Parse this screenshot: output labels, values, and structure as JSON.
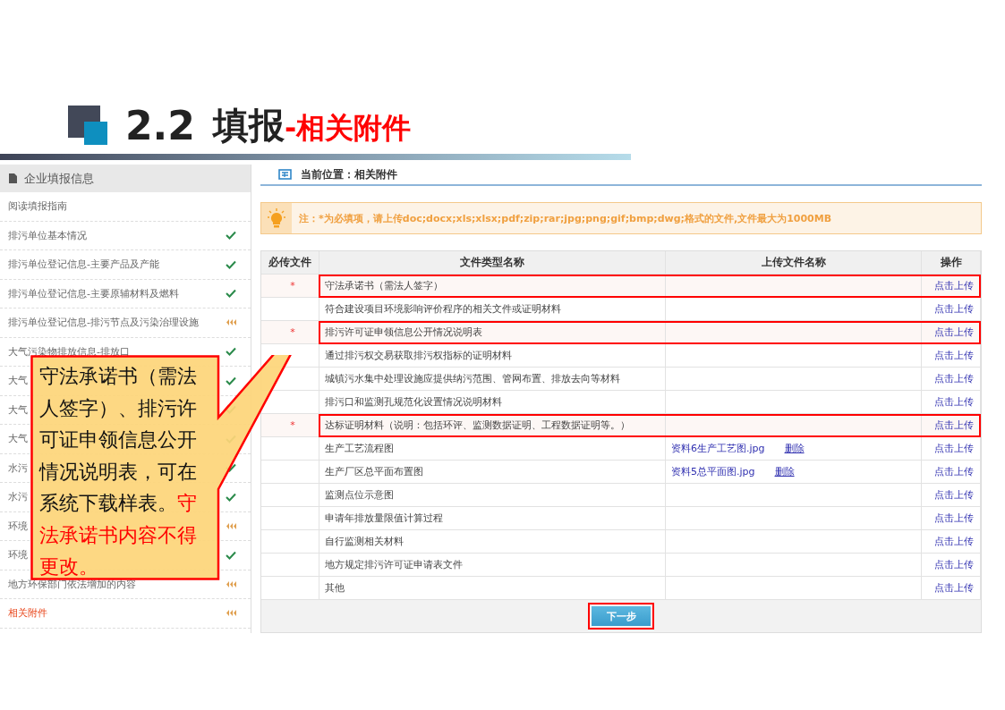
{
  "slide_title": {
    "number": "2.2",
    "main": "填报",
    "sub": "-相关附件"
  },
  "sidebar": {
    "title": "企业填报信息",
    "items": [
      {
        "label": "阅读填报指南",
        "selected": false
      },
      {
        "label": "排污单位基本情况",
        "completed": true,
        "selected": false
      },
      {
        "label": "排污单位登记信息-主要产品及产能",
        "completed": true,
        "selected": false
      },
      {
        "label": "排污单位登记信息-主要原辅材料及燃料",
        "completed": true,
        "selected": false
      },
      {
        "label": "排污单位登记信息-排污节点及污染治理设施",
        "completed": false,
        "selected": false
      },
      {
        "label": "大气污染物排放信息-排放口",
        "completed": true,
        "selected": false
      },
      {
        "label": "大气",
        "completed": true,
        "selected": false
      },
      {
        "label": "大气",
        "completed": true,
        "selected": false
      },
      {
        "label": "大气",
        "completed": true,
        "selected": false
      },
      {
        "label": "水污",
        "completed": true,
        "selected": false
      },
      {
        "label": "水污",
        "completed": true,
        "selected": false
      },
      {
        "label": "环境",
        "completed": false,
        "selected": false
      },
      {
        "label": "环境",
        "completed": true,
        "selected": false
      },
      {
        "label": "地方环保部门依法增加的内容",
        "completed": false,
        "selected": false
      },
      {
        "label": "相关附件",
        "completed": false,
        "selected": true
      }
    ]
  },
  "breadcrumb": "当前位置：相关附件",
  "notice": "注：*为必填项，请上传doc;docx;xls;xlsx;pdf;zip;rar;jpg;png;gif;bmp;dwg;格式的文件,文件最大为1000MB",
  "table": {
    "columns": [
      "必传文件",
      "文件类型名称",
      "上传文件名称",
      "操作"
    ],
    "rows": [
      {
        "mark": "*",
        "highlighted": true,
        "name": "守法承诺书（需法人签字）",
        "action": "点击上传"
      },
      {
        "highlighted": false,
        "name": "符合建设项目环境影响评价程序的相关文件或证明材料",
        "action": "点击上传"
      },
      {
        "mark": "*",
        "highlighted": true,
        "name": "排污许可证申领信息公开情况说明表",
        "action": "点击上传"
      },
      {
        "highlighted": false,
        "name": "通过排污权交易获取排污权指标的证明材料",
        "action": "点击上传"
      },
      {
        "highlighted": false,
        "name": "城镇污水集中处理设施应提供纳污范围、管网布置、排放去向等材料",
        "action": "点击上传"
      },
      {
        "highlighted": false,
        "name": "排污口和监测孔规范化设置情况说明材料",
        "action": "点击上传"
      },
      {
        "mark": "*",
        "highlighted": true,
        "name": "达标证明材料（说明：包括环评、监测数据证明、工程数据证明等。）",
        "action": "点击上传"
      },
      {
        "highlighted": false,
        "name": "生产工艺流程图",
        "file": "资料6生产工艺图.jpg",
        "delete": "删除",
        "action": "点击上传"
      },
      {
        "highlighted": false,
        "name": "生产厂区总平面布置图",
        "file": "资料5总平面图.jpg",
        "delete": "删除",
        "action": "点击上传"
      },
      {
        "highlighted": false,
        "name": "监测点位示意图",
        "action": "点击上传"
      },
      {
        "highlighted": false,
        "name": "申请年排放量限值计算过程",
        "action": "点击上传"
      },
      {
        "highlighted": false,
        "name": "自行监测相关材料",
        "action": "点击上传"
      },
      {
        "highlighted": false,
        "name": "地方规定排污许可证申请表文件",
        "action": "点击上传"
      },
      {
        "highlighted": false,
        "name": "其他",
        "action": "点击上传"
      }
    ]
  },
  "next_button": {
    "label": "下一步",
    "highlighted": true
  },
  "callout": {
    "text": "守法承诺书（需法人签字）、排污许可证申领信息公开情况说明表，可在系统下载样表。",
    "emphasis": "守法承诺书内容不得更改。"
  }
}
